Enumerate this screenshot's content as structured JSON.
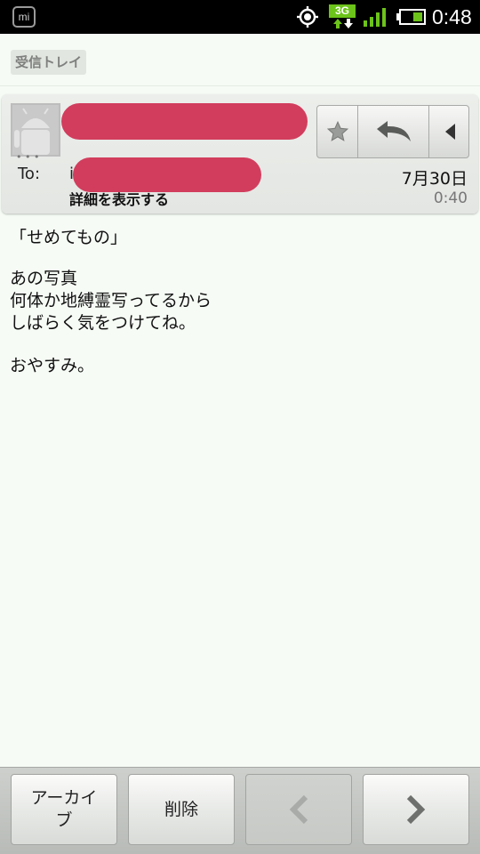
{
  "status_bar": {
    "app_icon": "mi-icon",
    "app_icon_text": "mi",
    "icons": [
      "gps-icon",
      "signal-icon",
      "battery-icon"
    ],
    "network": "3G",
    "time": "0:48"
  },
  "folder": {
    "label": "受信トレイ"
  },
  "header": {
    "to_label": "To:",
    "to_prefix": "i",
    "details_link": "詳細を表示する",
    "date": "7月30日",
    "time": "0:40",
    "actions": [
      "star-icon",
      "reply-icon",
      "more-icon"
    ]
  },
  "message": {
    "subject_line": "「せめてもの」",
    "lines": [
      "あの写真",
      "何体か地縛霊写ってるから",
      "しばらく気をつけてね。",
      "",
      "おやすみ。"
    ]
  },
  "bottom_bar": {
    "archive_label": "アーカイブ",
    "delete_label": "削除",
    "prev_icon": "chevron-left-icon",
    "next_icon": "chevron-right-icon"
  },
  "colors": {
    "redaction": "#d23d5d",
    "network_badge": "#6cc31a",
    "background": "#f6fbf5"
  }
}
